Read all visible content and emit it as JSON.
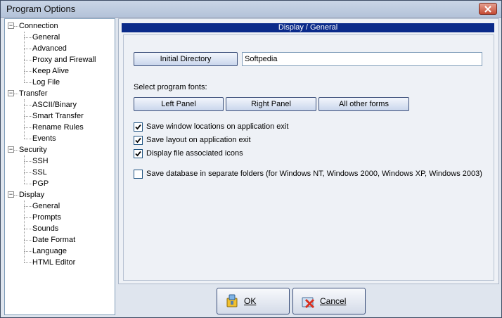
{
  "window": {
    "title": "Program Options"
  },
  "tree": {
    "groups": [
      {
        "label": "Connection",
        "children": [
          "General",
          "Advanced",
          "Proxy and Firewall",
          "Keep Alive",
          "Log File"
        ]
      },
      {
        "label": "Transfer",
        "children": [
          "ASCII/Binary",
          "Smart Transfer",
          "Rename Rules",
          "Events"
        ]
      },
      {
        "label": "Security",
        "children": [
          "SSH",
          "SSL",
          "PGP"
        ]
      },
      {
        "label": "Display",
        "children": [
          "General",
          "Prompts",
          "Sounds",
          "Date Format",
          "Language",
          "HTML Editor"
        ]
      }
    ],
    "expander_symbol": "−"
  },
  "panel": {
    "header": "Display / General",
    "initial_directory_button": "Initial Directory",
    "initial_directory_value": "Softpedia",
    "fonts_label": "Select program fonts:",
    "font_buttons": [
      "Left Panel",
      "Right Panel",
      "All other forms"
    ],
    "checkboxes": [
      {
        "label": "Save window locations on application exit",
        "checked": true
      },
      {
        "label": "Save layout on application exit",
        "checked": true
      },
      {
        "label": "Display file associated icons",
        "checked": true
      },
      {
        "label": "Save database in separate folders (for Windows NT, Windows 2000, Windows XP, Windows 2003)",
        "checked": false
      }
    ]
  },
  "buttons": {
    "ok": "OK",
    "cancel": "Cancel"
  },
  "colors": {
    "header_bg": "#0a2a8a",
    "close_button": "#c44a34"
  }
}
